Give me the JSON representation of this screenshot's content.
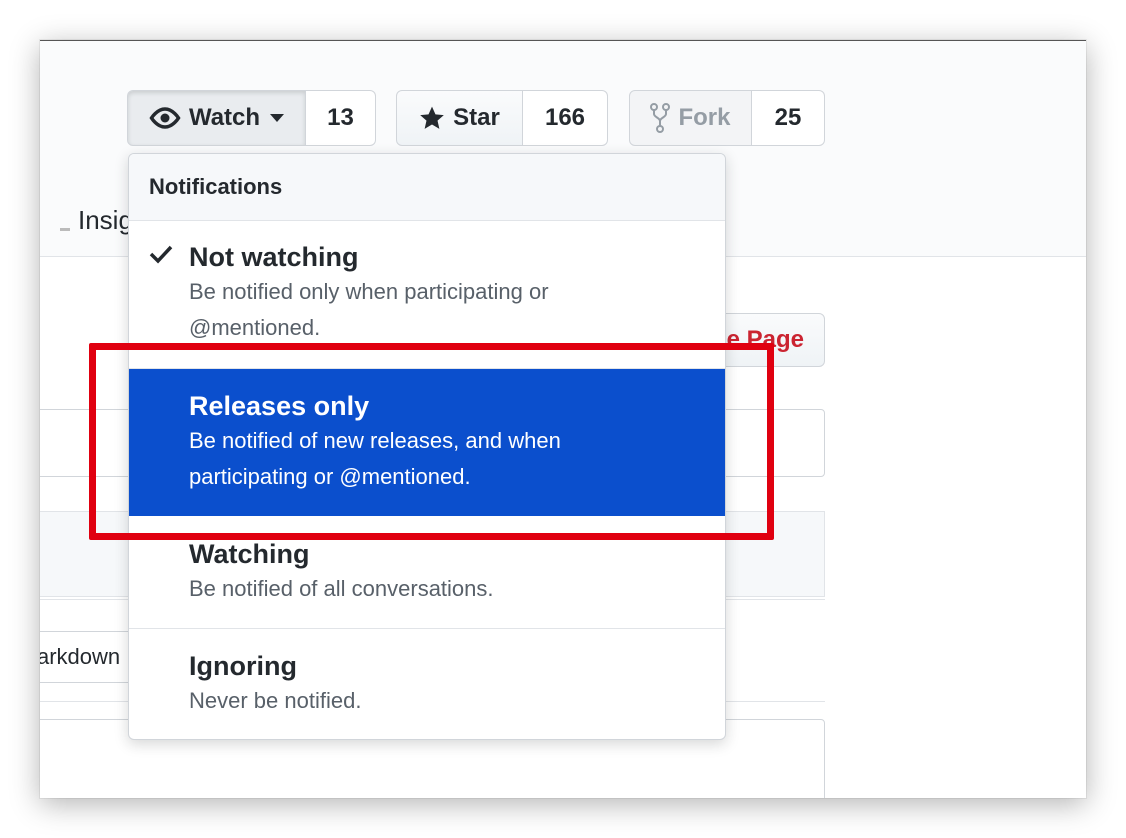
{
  "actions": {
    "watch": {
      "label": "Watch",
      "count": "13"
    },
    "star": {
      "label": "Star",
      "count": "166"
    },
    "fork": {
      "label": "Fork",
      "count": "25"
    }
  },
  "background": {
    "insights_tab": "Insigh",
    "page_button": "e Page",
    "markdown_tab": "arkdown"
  },
  "menu": {
    "header": "Notifications",
    "items": [
      {
        "title": "Not watching",
        "description": "Be notified only when participating or @mentioned.",
        "desc_lines": [
          "Be notified only when participating or",
          "@mentioned."
        ],
        "checked": true
      },
      {
        "title": "Releases only",
        "desc_lines": [
          "Be notified of new releases, and when",
          "participating or @mentioned."
        ],
        "selected": true
      },
      {
        "title": "Watching",
        "desc_lines": [
          "Be notified of all conversations."
        ]
      },
      {
        "title": "Ignoring",
        "desc_lines": [
          "Never be notified."
        ]
      }
    ]
  },
  "colors": {
    "selected_bg": "#0b4fcd",
    "highlight_border": "#e00010",
    "danger_text": "#cb2431"
  }
}
